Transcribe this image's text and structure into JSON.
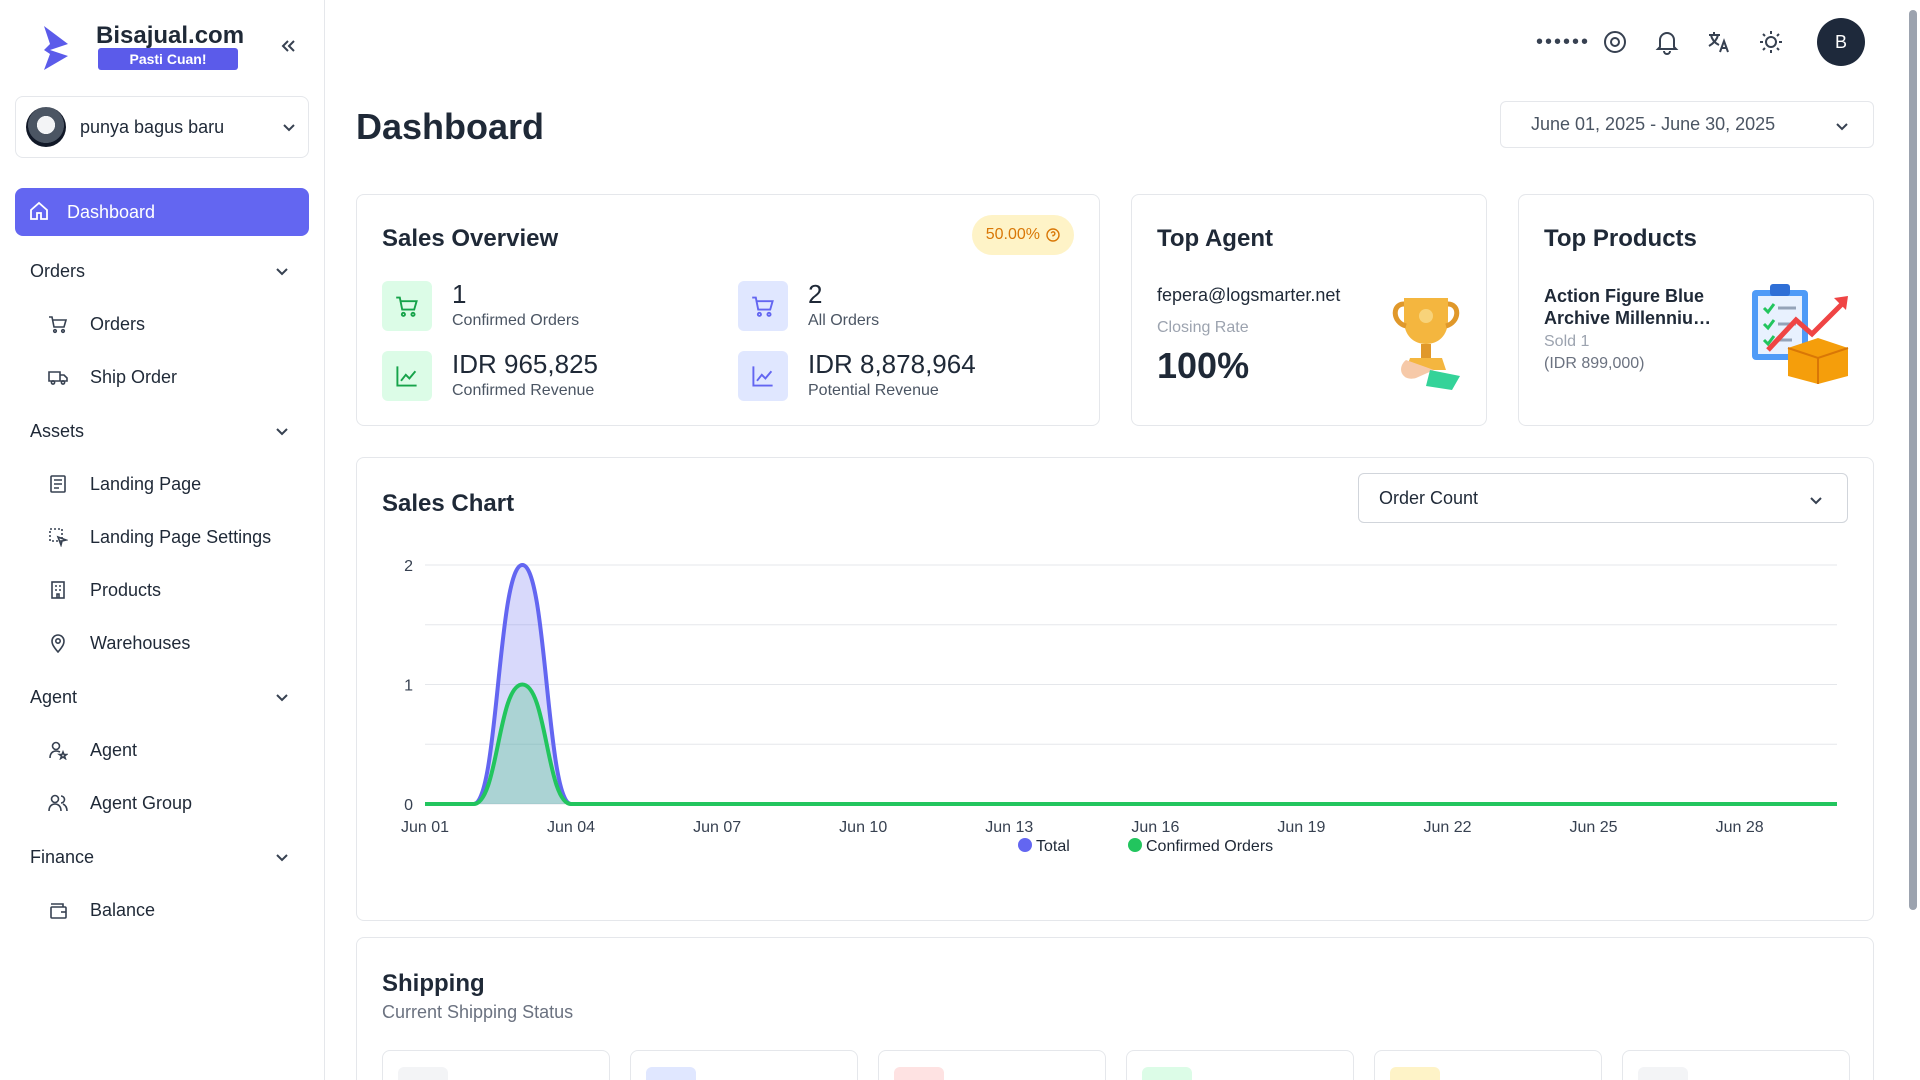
{
  "brand": {
    "name": "Bisajual.com",
    "tagline": "Pasti Cuan!"
  },
  "store": {
    "name": "punya bagus baru"
  },
  "nav": {
    "dashboard": "Dashboard",
    "groups": [
      {
        "label": "Orders",
        "items": [
          "Orders",
          "Ship Order"
        ]
      },
      {
        "label": "Assets",
        "items": [
          "Landing Page",
          "Landing Page Settings",
          "Products",
          "Warehouses"
        ]
      },
      {
        "label": "Agent",
        "items": [
          "Agent",
          "Agent Group"
        ]
      },
      {
        "label": "Finance",
        "items": [
          "Balance"
        ]
      }
    ]
  },
  "header": {
    "dots": "••••••",
    "avatar_initial": "B"
  },
  "page": {
    "title": "Dashboard",
    "date_range": "June 01, 2025 - June 30, 2025"
  },
  "sales_overview": {
    "title": "Sales Overview",
    "badge": "50.00%",
    "stats": [
      {
        "value": "1",
        "label": "Confirmed Orders"
      },
      {
        "value": "2",
        "label": "All Orders"
      },
      {
        "value": "IDR 965,825",
        "label": "Confirmed Revenue"
      },
      {
        "value": "IDR 8,878,964",
        "label": "Potential Revenue"
      }
    ]
  },
  "top_agent": {
    "title": "Top Agent",
    "email": "fepera@logsmarter.net",
    "label": "Closing Rate",
    "rate": "100%"
  },
  "top_products": {
    "title": "Top Products",
    "name": "Action Figure Blue Archive Millenniu…",
    "sold": "Sold 1",
    "price": "(IDR 899,000)"
  },
  "sales_chart": {
    "title": "Sales Chart",
    "metric": "Order Count"
  },
  "chart_data": {
    "type": "area",
    "x": [
      "Jun 01",
      "Jun 02",
      "Jun 03",
      "Jun 04",
      "Jun 05",
      "Jun 06",
      "Jun 07",
      "Jun 08",
      "Jun 09",
      "Jun 10",
      "Jun 11",
      "Jun 12",
      "Jun 13",
      "Jun 14",
      "Jun 15",
      "Jun 16",
      "Jun 17",
      "Jun 18",
      "Jun 19",
      "Jun 20",
      "Jun 21",
      "Jun 22",
      "Jun 23",
      "Jun 24",
      "Jun 25",
      "Jun 26",
      "Jun 27",
      "Jun 28",
      "Jun 29",
      "Jun 30"
    ],
    "x_tick_labels": [
      "Jun 01",
      "Jun 04",
      "Jun 07",
      "Jun 10",
      "Jun 13",
      "Jun 16",
      "Jun 19",
      "Jun 22",
      "Jun 25",
      "Jun 28"
    ],
    "y_tick_labels": [
      "0",
      "1",
      "2"
    ],
    "ylim": [
      0,
      2
    ],
    "series": [
      {
        "name": "Total",
        "color": "#6366f1",
        "values": [
          0,
          0,
          2,
          0,
          0,
          0,
          0,
          0,
          0,
          0,
          0,
          0,
          0,
          0,
          0,
          0,
          0,
          0,
          0,
          0,
          0,
          0,
          0,
          0,
          0,
          0,
          0,
          0,
          0,
          0
        ]
      },
      {
        "name": "Confirmed Orders",
        "color": "#22c55e",
        "values": [
          0,
          0,
          1,
          0,
          0,
          0,
          0,
          0,
          0,
          0,
          0,
          0,
          0,
          0,
          0,
          0,
          0,
          0,
          0,
          0,
          0,
          0,
          0,
          0,
          0,
          0,
          0,
          0,
          0,
          0
        ]
      }
    ],
    "legend": "bottom",
    "grid": true
  },
  "shipping": {
    "title": "Shipping",
    "subtitle": "Current Shipping Status"
  },
  "colors": {
    "accent": "#6366f1",
    "green": "#22c55e",
    "badge_bg": "#fef3c7",
    "badge_text": "#d97706"
  }
}
